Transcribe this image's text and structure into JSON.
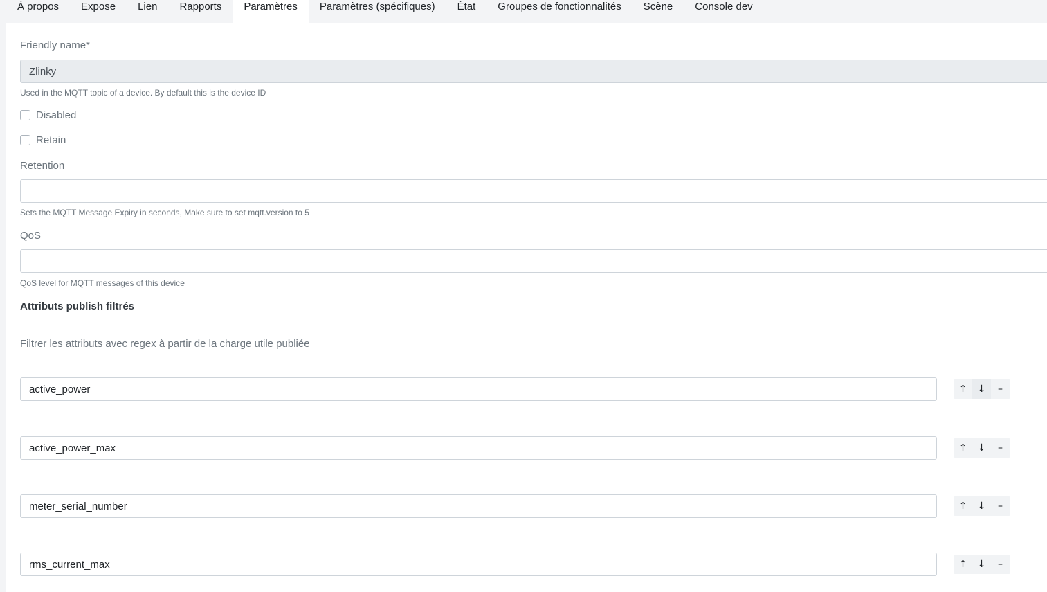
{
  "tabs": [
    {
      "label": "À propos"
    },
    {
      "label": "Expose"
    },
    {
      "label": "Lien"
    },
    {
      "label": "Rapports"
    },
    {
      "label": "Paramètres",
      "active": true
    },
    {
      "label": "Paramètres (spécifiques)"
    },
    {
      "label": "État"
    },
    {
      "label": "Groupes de fonctionnalités"
    },
    {
      "label": "Scène"
    },
    {
      "label": "Console dev"
    }
  ],
  "form": {
    "friendly_name": {
      "label": "Friendly name*",
      "value": "Zlinky",
      "help": "Used in the MQTT topic of a device. By default this is the device ID"
    },
    "disabled": {
      "label": "Disabled",
      "checked": false
    },
    "retain": {
      "label": "Retain",
      "checked": false
    },
    "retention": {
      "label": "Retention",
      "value": "",
      "help": "Sets the MQTT Message Expiry in seconds, Make sure to set mqtt.version to 5"
    },
    "qos": {
      "label": "QoS",
      "value": "",
      "help": "QoS level for MQTT messages of this device"
    }
  },
  "filtered": {
    "title": "Attributs publish filtrés",
    "description": "Filtrer les attributs avec regex à partir de la charge utile publiée",
    "items": [
      {
        "value": "active_power"
      },
      {
        "value": "active_power_max"
      },
      {
        "value": "meter_serial_number"
      },
      {
        "value": "rms_current_max"
      }
    ],
    "controls": {
      "up": "↑",
      "down": "↓",
      "remove": "–"
    }
  }
}
